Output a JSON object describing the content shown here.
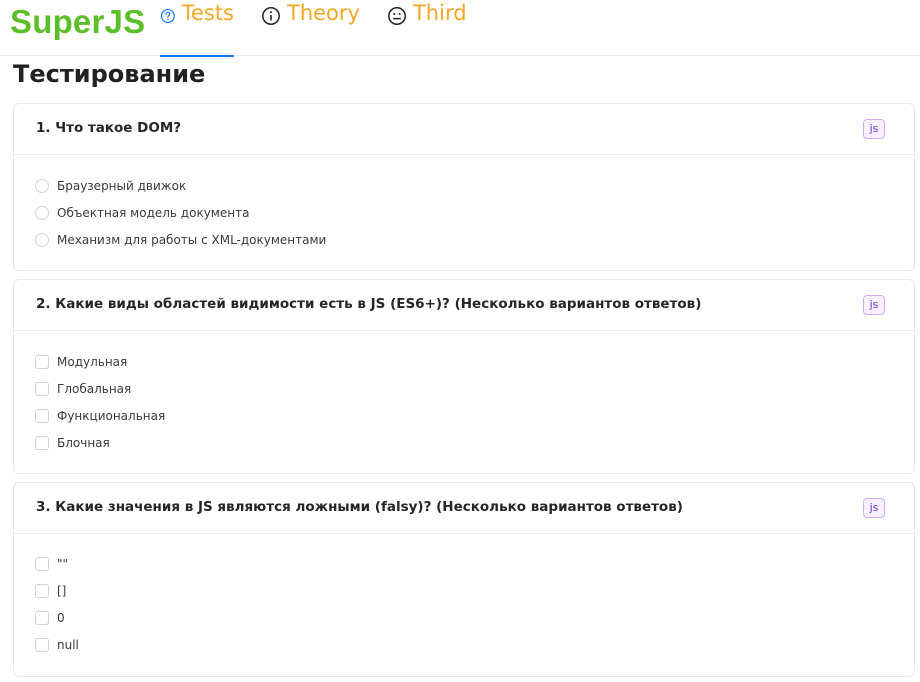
{
  "header": {
    "logo": "SuperJS",
    "tabs": [
      {
        "label": "Tests",
        "icon": "question-circle-icon",
        "active": true
      },
      {
        "label": "Theory",
        "icon": "info-circle-icon",
        "active": false
      },
      {
        "label": "Third",
        "icon": "meh-face-icon",
        "active": false
      }
    ]
  },
  "page": {
    "title": "Тестирование"
  },
  "questions": [
    {
      "title": "1. Что такое DOM?",
      "tag": "js",
      "input_type": "radio",
      "options": [
        "Браузерный движок",
        "Объектная модель документа",
        "Механизм для работы с XML-документами"
      ]
    },
    {
      "title": "2. Какие виды областей видимости есть в JS (ES6+)? (Несколько вариантов ответов)",
      "tag": "js",
      "input_type": "checkbox",
      "options": [
        "Модульная",
        "Глобальная",
        "Функциональная",
        "Блочная"
      ]
    },
    {
      "title": "3. Какие значения в JS являются ложными (falsy)? (Несколько вариантов ответов)",
      "tag": "js",
      "input_type": "checkbox",
      "options": [
        "\"\"",
        "[]",
        "0",
        "null"
      ]
    }
  ],
  "colors": {
    "logo": "#5cbf2a",
    "tab_text": "#f5a623",
    "tab_icon_active": "#1677ff",
    "tab_underline": "#1677ff",
    "tag_text": "#722ed1",
    "tag_bg": "#f9f0ff",
    "tag_border": "#d3adf7"
  }
}
